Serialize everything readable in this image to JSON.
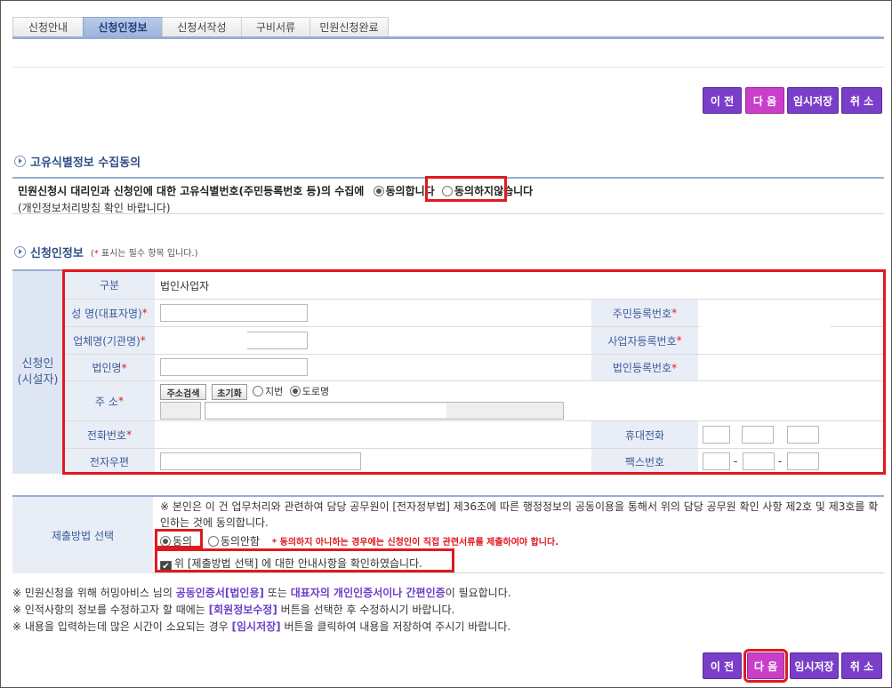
{
  "tabs": [
    "신청안내",
    "신청인정보",
    "신청서작성",
    "구비서류",
    "민원신청완료"
  ],
  "buttons": {
    "prev": "이 전",
    "next": "다 음",
    "save": "임시저장",
    "cancel": "취 소"
  },
  "section1": {
    "title": "고유식별정보 수집동의",
    "question": "민원신청시 대리인과 신청인에 대한 고유식별번호(주민등록번호 등)의 수집에",
    "agree": "동의합니다",
    "disagree": "동의하지않습니다",
    "sub": "(개인정보처리방침 확인 바랍니다)"
  },
  "section2": {
    "title": "신청인정보",
    "note_open": "(",
    "note_star": "*",
    "note_text": " 표시는 필수 항목 입니다.)"
  },
  "applicant": {
    "side_label_1": "신청인",
    "side_label_2": "(시설자)",
    "type_label": "구분",
    "type_value": "법인사업자",
    "rep_name": "성 명(대표자명)",
    "resident_no": "주민등록번호",
    "company_name": "업체명(기관명)",
    "biz_no": "사업자등록번호",
    "corp_name": "법인명",
    "corp_no": "법인등록번호",
    "address": "주 소",
    "addr_search": "주소검색",
    "addr_reset": "초기화",
    "addr_jibun": "지번",
    "addr_road": "도로명",
    "phone": "전화번호",
    "mobile": "휴대전화",
    "email": "전자우편",
    "fax": "팩스번호",
    "dash": "-",
    "star": "*"
  },
  "submission": {
    "label": "제출방법 선택",
    "text": "※ 본인은 이 건 업무처리와 관련하여 담당 공무원이 [전자정부법] 제36조에 따른 행정정보의 공동이용을 통해서 위의 담당 공무원 확인 사항 제2호 및 제3호를 확인하는 것에 동의합니다.",
    "agree": "동의",
    "disagree": "동의안함",
    "warning": "* 동의하지 아니하는 경우에는 신청인이 직접 관련서류를 제출하여야 합니다.",
    "check": "위 [제출방법 선택] 에 대한 안내사항을 확인하였습니다."
  },
  "notes": {
    "n1_a": "※ 민원신청을 위해 허밍아비스 님의 ",
    "n1_b": "공동인증서[법인용]",
    "n1_c": " 또는 ",
    "n1_d": "대표자의 개인인증서이나 간편인증",
    "n1_e": "이 필요합니다.",
    "n2_a": "※ 인적사항의 정보를 수정하고자 할 때에는 ",
    "n2_b": "[회원정보수정]",
    "n2_c": " 버튼을 선택한 후 수정하시기 바랍니다.",
    "n3_a": "※ 내용을 입력하는데 많은 시간이 소요되는 경우 ",
    "n3_b": "[임시저장]",
    "n3_c": " 버튼을 클릭하여 내용을 저장하여 주시기 바랍니다."
  },
  "colors": {
    "accent": "#7a3fc9",
    "pink": "#c93fc9",
    "highlight": "#e0191f",
    "header_blue": "#97acd3"
  }
}
